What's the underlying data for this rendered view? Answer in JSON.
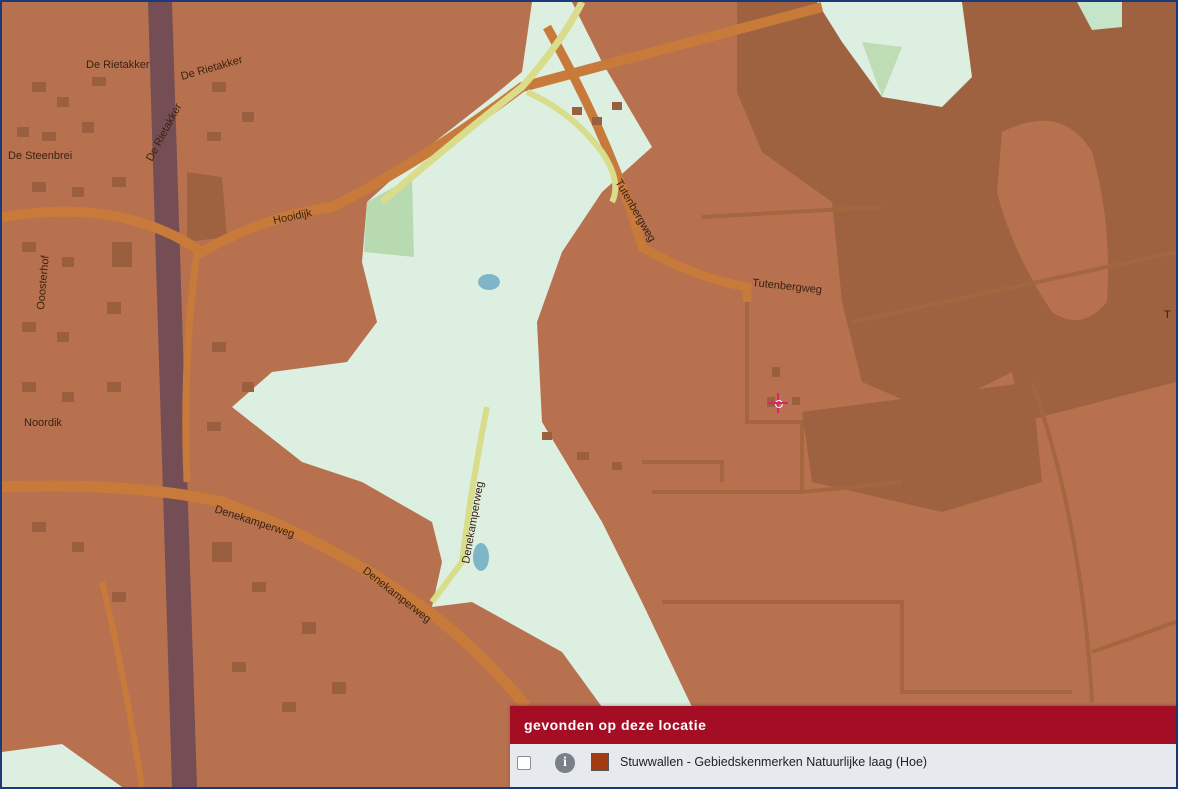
{
  "map": {
    "streets": [
      {
        "id": "rietakker-1",
        "name": "De Rietakker"
      },
      {
        "id": "rietakker-2",
        "name": "De Rietakker"
      },
      {
        "id": "rietakker-3",
        "name": "De Rietakker"
      },
      {
        "id": "steenbrei",
        "name": "De Steenbrei"
      },
      {
        "id": "hooidijk",
        "name": "Hooidijk"
      },
      {
        "id": "oosterhof",
        "name": "Ooosterhof"
      },
      {
        "id": "noordik",
        "name": "Noordik"
      },
      {
        "id": "tutenbergweg-1",
        "name": "Tutenbergweg"
      },
      {
        "id": "tutenbergweg-2",
        "name": "Tutenbergweg"
      },
      {
        "id": "denekamperweg-1",
        "name": "Denekamperweg"
      },
      {
        "id": "denekamperweg-2",
        "name": "Denekamperweg"
      },
      {
        "id": "denekamperweg-3",
        "name": "Denekamperweg"
      },
      {
        "id": "edge-t",
        "name": "T"
      }
    ],
    "marker": {
      "icon": "location-crosshair-icon"
    }
  },
  "colors": {
    "layer_fill": "#b7714f",
    "layer_dark": "#9e6240",
    "open_area": "#dcefe0",
    "green": "#a9d1a6",
    "water": "#7fb5c8",
    "road": "#c87a3a",
    "marker": "#e0206a",
    "panel_header": "#a50d25",
    "border": "#1d3a78"
  },
  "panel": {
    "title": "gevonden op deze locatie",
    "rows": [
      {
        "checkbox_checked": false,
        "info_icon": "info-icon",
        "swatch_color": "#a23a12",
        "label": "Stuwwallen - Gebiedskenmerken Natuurlijke laag (Hoe)"
      }
    ]
  }
}
